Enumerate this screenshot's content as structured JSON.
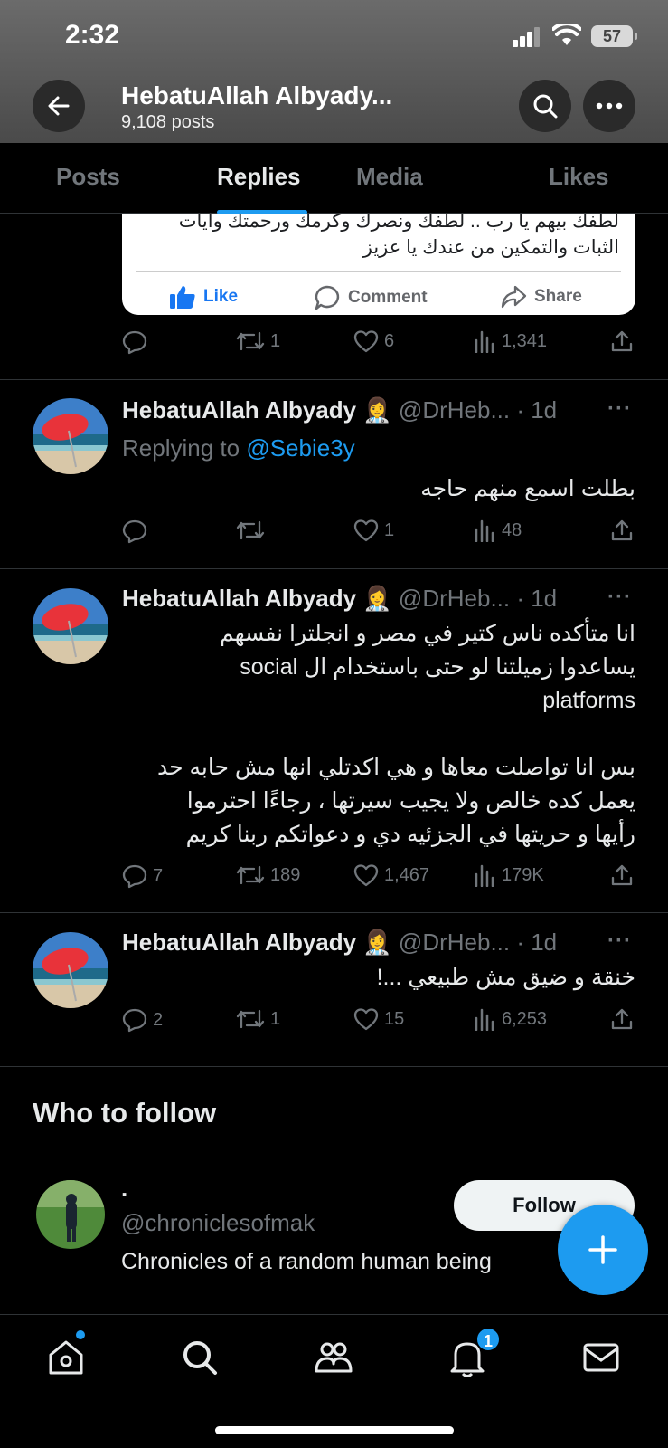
{
  "status_bar": {
    "time": "2:32",
    "battery": "57"
  },
  "header": {
    "title": "HebatuAllah Albyady...",
    "post_count": "9,108 posts"
  },
  "tabs": [
    {
      "label": "Posts"
    },
    {
      "label": "Replies"
    },
    {
      "label": "Media"
    },
    {
      "label": "Likes"
    }
  ],
  "embedded_card": {
    "text_line1": "لطفك بيهم يا رب .. لطفك ونصرك وكرمك ورحمتك وايات",
    "text_line2": "الثبات والتمكين من عندك يا عزيز",
    "like": "Like",
    "comment": "Comment",
    "share": "Share"
  },
  "card_stats": {
    "replies": "",
    "reposts": "1",
    "likes": "6",
    "views": "1,341"
  },
  "tweets": [
    {
      "name": "HebatuAllah Albyady 👩‍⚕️",
      "handle": "@DrHeb... · 1d",
      "replying_prefix": "Replying to ",
      "replying_to": "@Sebie3y",
      "body": "بطلت اسمع منهم حاجه",
      "replies": "",
      "reposts": "",
      "likes": "1",
      "views": "48"
    },
    {
      "name": "HebatuAllah Albyady 👩‍⚕️",
      "handle": "@DrHeb... · 1d",
      "body": "انا متأكده ناس كتير في مصر و انجلترا نفسهم\nيساعدوا زميلتنا لو حتى باستخدام ال social\nplatforms\n\nبس انا تواصلت معاها و هي اكدتلي انها مش حابه حد\nيعمل كده خالص ولا يجيب سيرتها ، رجاءًا احترموا\nرأيها و حريتها في الجزئيه دي و دعواتكم ربنا كريم",
      "replies": "7",
      "reposts": "189",
      "likes": "1,467",
      "views": "179K"
    },
    {
      "name": "HebatuAllah Albyady 👩‍⚕️",
      "handle": "@DrHeb... · 1d",
      "body": "خنقة و ضيق مش طبيعي ...!",
      "replies": "2",
      "reposts": "1",
      "likes": "15",
      "views": "6,253"
    }
  ],
  "who_to_follow": {
    "title": "Who to follow",
    "name": ".",
    "handle": "@chroniclesofmak",
    "bio": "Chronicles of a random human being",
    "follow_label": "Follow"
  },
  "bottom_nav": {
    "notification_count": "1"
  },
  "colors": {
    "accent": "#1d9bf0",
    "background": "#000000",
    "muted": "#71767b"
  }
}
